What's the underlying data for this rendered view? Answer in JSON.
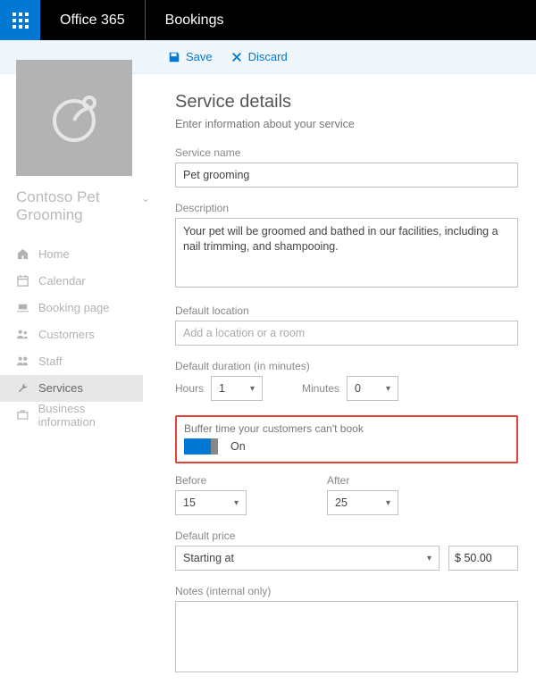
{
  "header": {
    "brand": "Office 365",
    "app": "Bookings"
  },
  "toolbar": {
    "save_label": "Save",
    "discard_label": "Discard"
  },
  "sidebar": {
    "business_name": "Contoso Pet Grooming",
    "items": [
      {
        "label": "Home"
      },
      {
        "label": "Calendar"
      },
      {
        "label": "Booking page"
      },
      {
        "label": "Customers"
      },
      {
        "label": "Staff"
      },
      {
        "label": "Services"
      },
      {
        "label": "Business information"
      }
    ],
    "active_index": 5
  },
  "page": {
    "title": "Service details",
    "subtitle": "Enter information about your service"
  },
  "fields": {
    "service_name": {
      "label": "Service name",
      "value": "Pet grooming"
    },
    "description": {
      "label": "Description",
      "value": "Your pet will be groomed and bathed in our facilities, including a nail trimming, and shampooing."
    },
    "default_location": {
      "label": "Default location",
      "placeholder": "Add a location or a room",
      "value": ""
    },
    "default_duration": {
      "label": "Default duration (in minutes)",
      "hours_label": "Hours",
      "hours_value": "1",
      "minutes_label": "Minutes",
      "minutes_value": "0"
    },
    "buffer": {
      "label": "Buffer time your customers can't book",
      "toggle_state": "On",
      "before_label": "Before",
      "before_value": "15",
      "after_label": "After",
      "after_value": "25"
    },
    "default_price": {
      "label": "Default price",
      "type": "Starting at",
      "currency": "$",
      "amount": "50.00"
    },
    "notes": {
      "label": "Notes (internal only)",
      "value": ""
    }
  }
}
